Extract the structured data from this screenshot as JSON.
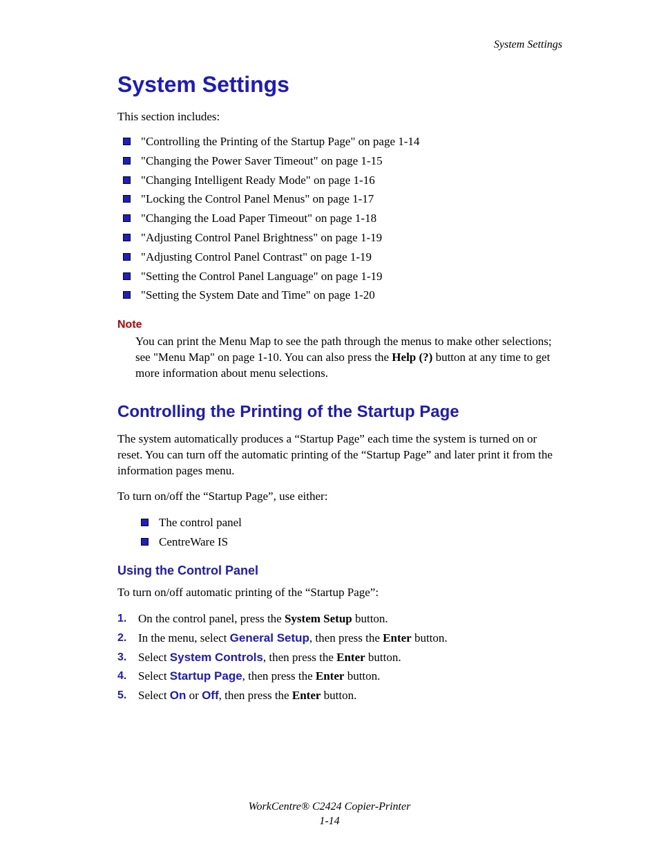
{
  "running_head": "System Settings",
  "title": "System Settings",
  "intro": "This section includes:",
  "toc": [
    "\"Controlling the Printing of the Startup Page\" on page 1-14",
    "\"Changing the Power Saver Timeout\" on page 1-15",
    "\"Changing Intelligent Ready Mode\" on page 1-16",
    "\"Locking the Control Panel Menus\" on page 1-17",
    "\"Changing the Load Paper Timeout\" on page 1-18",
    "\"Adjusting Control Panel Brightness\" on page 1-19",
    "\"Adjusting Control Panel Contrast\" on page 1-19",
    "\"Setting the Control Panel Language\" on page 1-19",
    "\"Setting the System Date and Time\" on page 1-20"
  ],
  "note": {
    "label": "Note",
    "pre": "You can print the Menu Map to see the path through the menus to make other selections; see \"Menu Map\" on page 1-10. You can also press the ",
    "bold": "Help (?)",
    "post": " button at any time to get more information about menu selections."
  },
  "section1": {
    "heading": "Controlling the Printing of the Startup Page",
    "p1": "The system automatically produces a “Startup Page” each time the system is turned on or reset. You can turn off the automatic printing of the “Startup Page” and later print it from the information pages menu.",
    "p2": "To turn on/off the “Startup Page”, use either:",
    "options": [
      "The control panel",
      "CentreWare IS"
    ]
  },
  "sub1": {
    "heading": "Using the Control Panel",
    "intro": "To turn on/off automatic printing of the “Startup Page”:",
    "steps": {
      "s1": {
        "num": "1.",
        "pre": "On the control panel, press the ",
        "b1": "System Setup",
        "post": " button."
      },
      "s2": {
        "num": "2.",
        "pre": "In the menu, select ",
        "blue": "General Setup",
        "mid": ", then press the ",
        "b1": "Enter",
        "post": " button."
      },
      "s3": {
        "num": "3.",
        "pre": "Select ",
        "blue": "System Controls",
        "mid": ", then press the ",
        "b1": "Enter",
        "post": " button."
      },
      "s4": {
        "num": "4.",
        "pre": "Select ",
        "blue": "Startup Page",
        "mid": ", then press the ",
        "b1": "Enter",
        "post": " button."
      },
      "s5": {
        "num": "5.",
        "pre": "Select ",
        "blue1": "On",
        "or": " or ",
        "blue2": "Off",
        "mid": ", then press the ",
        "b1": "Enter",
        "post": " button."
      }
    }
  },
  "footer": {
    "product": "WorkCentre® C2424 Copier-Printer",
    "page": "1-14"
  }
}
